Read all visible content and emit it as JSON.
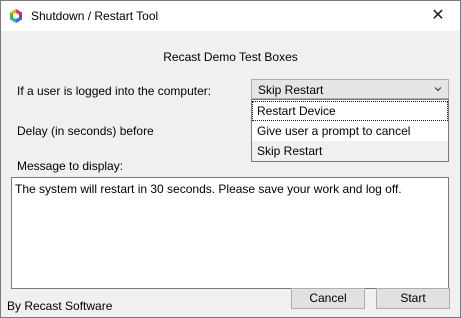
{
  "window": {
    "title": "Shutdown / Restart Tool",
    "close_glyph": "✕",
    "app_icon": "recast-logo-icon"
  },
  "form": {
    "heading": "Recast Demo Test Boxes",
    "logged_in_label": "If a user is logged into the computer:",
    "delay_label": "Delay (in seconds) before",
    "message_label": "Message to display:",
    "combo": {
      "selected": "Skip Restart",
      "arrow_icon": "chevron-down-icon",
      "options": [
        "Restart Device",
        "Give user a prompt to cancel",
        "Skip Restart"
      ]
    },
    "message_text": "The system will restart in 30 seconds.  Please save your work and log off."
  },
  "footer": {
    "credit": "By Recast Software",
    "cancel_label": "Cancel",
    "start_label": "Start"
  },
  "colors": {
    "title_bg": "#ffffff",
    "client_bg": "#f0f0f0",
    "button_bg": "#e1e1e1"
  }
}
